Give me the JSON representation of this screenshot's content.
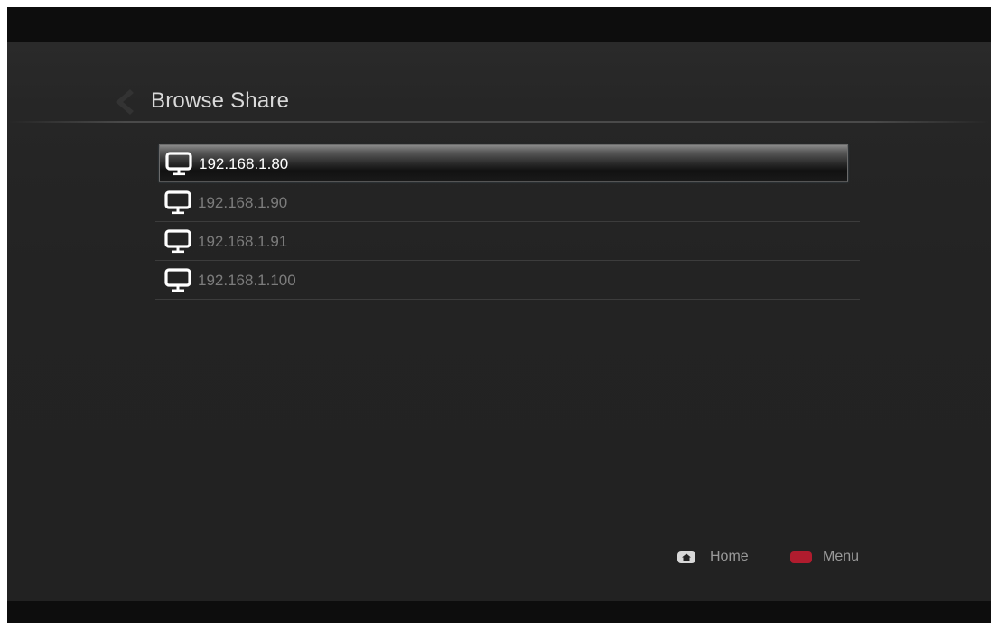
{
  "header": {
    "title": "Browse Share",
    "back_icon": "chevron-left-icon"
  },
  "list": {
    "items": [
      {
        "label": "192.168.1.80",
        "icon": "computer-monitor-icon",
        "selected": true
      },
      {
        "label": "192.168.1.90",
        "icon": "computer-monitor-icon",
        "selected": false
      },
      {
        "label": "192.168.1.91",
        "icon": "computer-monitor-icon",
        "selected": false
      },
      {
        "label": "192.168.1.100",
        "icon": "computer-monitor-icon",
        "selected": false
      }
    ]
  },
  "footer": {
    "home_label": "Home",
    "home_icon": "home-button-icon",
    "menu_label": "Menu",
    "menu_icon": "red-button-icon"
  },
  "colors": {
    "background": "#222222",
    "menu_key": "#b01c2e",
    "selected_text": "#ffffff",
    "item_text": "#7c7c7c"
  }
}
